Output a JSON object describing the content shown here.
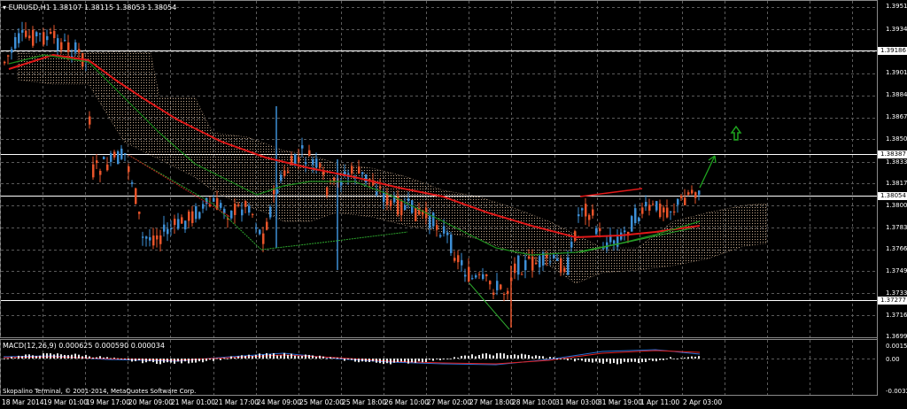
{
  "header": {
    "symbol_label": "EURUSD,H1",
    "ohlc": "1.38107 1.38115 1.38053 1.38054"
  },
  "macd": {
    "label": "MACD(12,26,9) 0.000625 0.000590 0.000034"
  },
  "copyright": "Skopalino Terminal, © 2001-2014, MetaQuotes Software Corp.",
  "price_axis": [
    "1.39510",
    "1.39345",
    "1.39186",
    "1.39010",
    "1.38840",
    "1.38670",
    "1.38505",
    "1.38387",
    "1.38335",
    "1.38170",
    "1.38054",
    "1.38000",
    "1.37830",
    "1.37665",
    "1.37495",
    "1.37330",
    "1.37277",
    "1.37160",
    "1.36995"
  ],
  "macd_axis": [
    "0.001504",
    "0.00",
    "-0.003242"
  ],
  "time_axis": [
    "18 Mar 2014",
    "19 Mar 01:00",
    "19 Mar 17:00",
    "20 Mar 09:00",
    "21 Mar 01:00",
    "21 Mar 17:00",
    "24 Mar 09:00",
    "25 Mar 02:00",
    "25 Mar 18:00",
    "26 Mar 10:00",
    "27 Mar 02:00",
    "27 Mar 18:00",
    "28 Mar 10:00",
    "31 Mar 03:00",
    "31 Mar 19:00",
    "1 Apr 11:00",
    "2 Apr 03:00"
  ],
  "colors": {
    "background": "#000000",
    "grid": "#5a5a5a",
    "bull_candle": "#3d8fd6",
    "bear_candle": "#e8542a",
    "ma_slow": "#e01818",
    "ma_medium": "#1c8c1c",
    "cloud": "#d8b89a",
    "signal_arrow": "#1fa51f"
  }
}
